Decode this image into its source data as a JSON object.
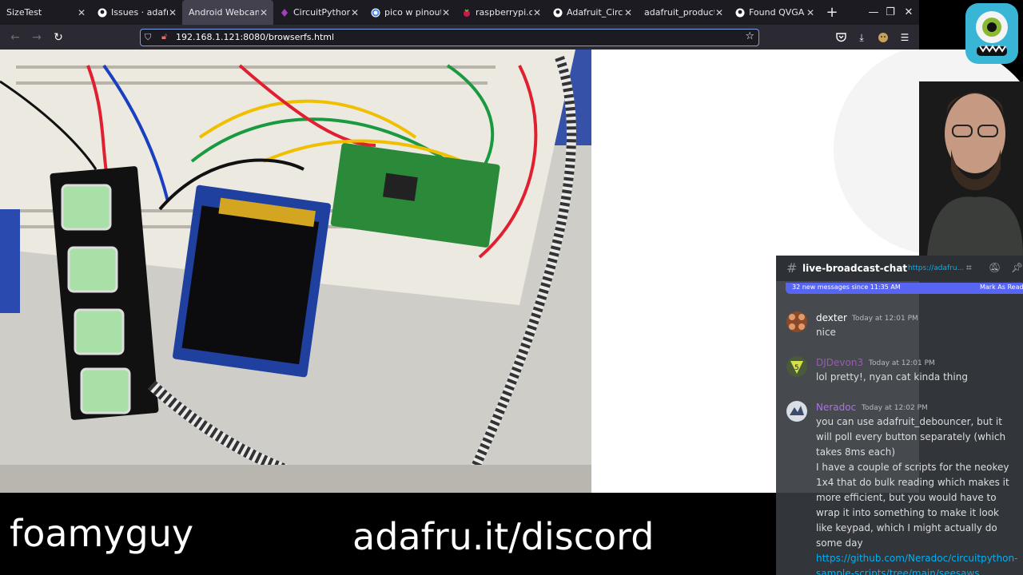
{
  "browser": {
    "tabs": [
      {
        "title": "SizeTest",
        "icon": "blank-page-icon",
        "active": false
      },
      {
        "title": "Issues · adafruit",
        "icon": "github-icon",
        "active": false
      },
      {
        "title": "Android Webcam S",
        "icon": "none",
        "active": true
      },
      {
        "title": "CircuitPython",
        "icon": "circuitpython-icon",
        "active": false
      },
      {
        "title": "pico w pinout - G",
        "icon": "google-icon",
        "active": false
      },
      {
        "title": "raspberrypi.com",
        "icon": "raspberry-icon",
        "active": false
      },
      {
        "title": "Adafruit_Circuit",
        "icon": "github-icon",
        "active": false
      },
      {
        "title": "adafruit_products_",
        "icon": "none",
        "active": false
      },
      {
        "title": "Found QVGA TF",
        "icon": "github-icon",
        "active": false
      }
    ],
    "url": "192.168.1.121:8080/browserfs.html"
  },
  "discord": {
    "channel": "live-broadcast-chat",
    "topic_link": "https://adafru...",
    "new_messages_text": "32 new messages since 11:35 AM",
    "mark_as_read": "Mark As Read",
    "messages": [
      {
        "author": "dexter",
        "color": "#ffffff",
        "time": "Today at 12:01 PM",
        "lines": [
          "nice"
        ]
      },
      {
        "author": "DJDevon3",
        "color": "#9b59b6",
        "time": "Today at 12:01 PM",
        "lines": [
          "lol pretty!, nyan cat kinda thing"
        ]
      },
      {
        "author": "Neradoc",
        "color": "#b070e8",
        "time": "Today at 12:02 PM",
        "lines": [
          "you can use adafruit_debouncer, but it will poll every button separately (which takes 8ms each)",
          "I have a couple of scripts for the neokey 1x4 that do bulk reading which makes it more efficient, but you would have to wrap it into something to make it look like keypad, which I might actually do some day"
        ],
        "link": "https://github.com/Neradoc/circuitpython-sample-scripts/tree/main/seesaws"
      }
    ]
  },
  "overlay": {
    "handle": "foamyguy",
    "discord_url": "adafru.it/discord"
  }
}
